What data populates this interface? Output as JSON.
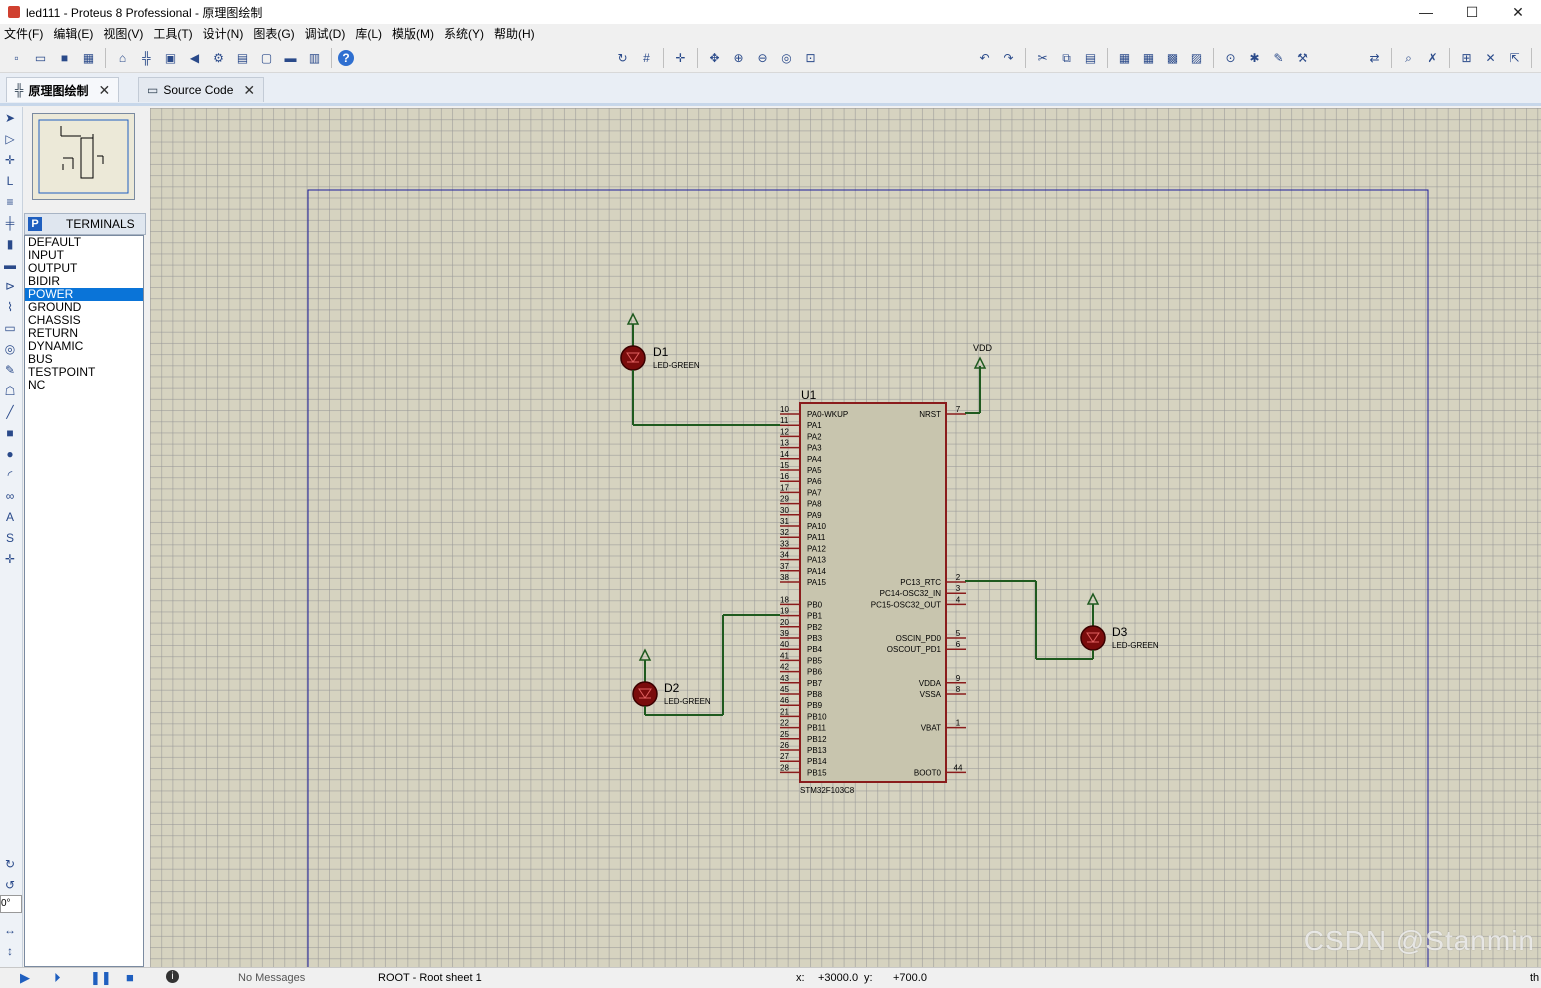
{
  "window": {
    "title": "led111 - Proteus 8 Professional - 原理图绘制",
    "minimize": "—",
    "maximize": "☐",
    "close": "✕"
  },
  "menu": [
    "文件(F)",
    "编辑(E)",
    "视图(V)",
    "工具(T)",
    "设计(N)",
    "图表(G)",
    "调试(D)",
    "库(L)",
    "模版(M)",
    "系统(Y)",
    "帮助(H)"
  ],
  "toolbar": {
    "help_icon": "?"
  },
  "tabs": [
    {
      "label": "原理图绘制",
      "close": "✕",
      "icon": "schematic-icon"
    },
    {
      "label": "Source Code",
      "close": "✕",
      "icon": "source-code-icon"
    }
  ],
  "terminals": {
    "badge": "P",
    "title": "TERMINALS",
    "items": [
      "DEFAULT",
      "INPUT",
      "OUTPUT",
      "BIDIR",
      "POWER",
      "GROUND",
      "CHASSIS",
      "RETURN",
      "DYNAMIC",
      "BUS",
      "TESTPOINT",
      "NC"
    ],
    "selected": "POWER"
  },
  "rotation": "0°",
  "schematic": {
    "chip": {
      "ref": "U1",
      "part": "STM32F103C8",
      "left_pins": [
        {
          "num": "10",
          "name": "PA0-WKUP"
        },
        {
          "num": "11",
          "name": "PA1"
        },
        {
          "num": "12",
          "name": "PA2"
        },
        {
          "num": "13",
          "name": "PA3"
        },
        {
          "num": "14",
          "name": "PA4"
        },
        {
          "num": "15",
          "name": "PA5"
        },
        {
          "num": "16",
          "name": "PA6"
        },
        {
          "num": "17",
          "name": "PA7"
        },
        {
          "num": "29",
          "name": "PA8"
        },
        {
          "num": "30",
          "name": "PA9"
        },
        {
          "num": "31",
          "name": "PA10"
        },
        {
          "num": "32",
          "name": "PA11"
        },
        {
          "num": "33",
          "name": "PA12"
        },
        {
          "num": "34",
          "name": "PA13"
        },
        {
          "num": "37",
          "name": "PA14"
        },
        {
          "num": "38",
          "name": "PA15"
        },
        {
          "num": "",
          "name": ""
        },
        {
          "num": "18",
          "name": "PB0"
        },
        {
          "num": "19",
          "name": "PB1"
        },
        {
          "num": "20",
          "name": "PB2"
        },
        {
          "num": "39",
          "name": "PB3"
        },
        {
          "num": "40",
          "name": "PB4"
        },
        {
          "num": "41",
          "name": "PB5"
        },
        {
          "num": "42",
          "name": "PB6"
        },
        {
          "num": "43",
          "name": "PB7"
        },
        {
          "num": "45",
          "name": "PB8"
        },
        {
          "num": "46",
          "name": "PB9"
        },
        {
          "num": "21",
          "name": "PB10"
        },
        {
          "num": "22",
          "name": "PB11"
        },
        {
          "num": "25",
          "name": "PB12"
        },
        {
          "num": "26",
          "name": "PB13"
        },
        {
          "num": "27",
          "name": "PB14"
        },
        {
          "num": "28",
          "name": "PB15"
        }
      ],
      "right_pins": [
        {
          "num": "7",
          "name": "NRST",
          "row": 0
        },
        {
          "num": "2",
          "name": "PC13_RTC",
          "row": 15
        },
        {
          "num": "3",
          "name": "PC14-OSC32_IN",
          "row": 16
        },
        {
          "num": "4",
          "name": "PC15-OSC32_OUT",
          "row": 17
        },
        {
          "num": "5",
          "name": "OSCIN_PD0",
          "row": 20
        },
        {
          "num": "6",
          "name": "OSCOUT_PD1",
          "row": 21
        },
        {
          "num": "9",
          "name": "VDDA",
          "row": 24
        },
        {
          "num": "8",
          "name": "VSSA",
          "row": 25
        },
        {
          "num": "1",
          "name": "VBAT",
          "row": 28
        },
        {
          "num": "44",
          "name": "BOOT0",
          "row": 32
        }
      ]
    },
    "leds": [
      {
        "ref": "D1",
        "value": "LED-GREEN"
      },
      {
        "ref": "D2",
        "value": "LED-GREEN"
      },
      {
        "ref": "D3",
        "value": "LED-GREEN"
      }
    ],
    "vdd_label": "VDD"
  },
  "status": {
    "messages": "No Messages",
    "sheet": "ROOT - Root sheet 1",
    "x_label": "x:",
    "x_value": "+3000.0",
    "y_label": "y:",
    "y_value": "+700.0",
    "tail": "th"
  },
  "watermark": "CSDN @Stanmin",
  "colors": {
    "canvas_bg": "#d6d3c0",
    "sheet_border": "#1c1c9c",
    "chip_body": "#c8c5ae",
    "chip_outline": "#8a1c1c",
    "wire": "#1f5a1f",
    "led_body": "#7a0c0c",
    "selected": "#0a74d8"
  }
}
